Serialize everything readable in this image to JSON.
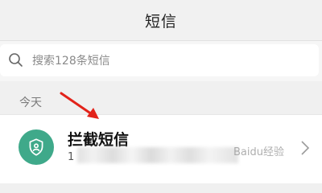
{
  "header": {
    "title": "短信"
  },
  "search": {
    "placeholder": "搜索128条短信",
    "icon": "search-icon"
  },
  "section": {
    "label": "今天"
  },
  "conversation": {
    "title": "拦截短信",
    "subtitle_prefix": "1",
    "avatar_icon": "shield-icon",
    "avatar_color": "#3fa98a"
  },
  "annotation": {
    "color": "#e2231a"
  },
  "watermark": {
    "text": "Baidu经验"
  }
}
